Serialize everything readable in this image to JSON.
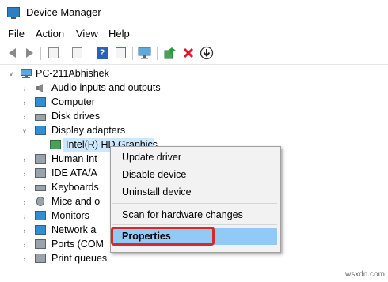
{
  "window": {
    "title": "Device Manager"
  },
  "menubar": [
    "File",
    "Action",
    "View",
    "Help"
  ],
  "toolbar": {
    "icons": [
      "back-arrow-icon",
      "forward-arrow-icon",
      "properties-sheet-icon",
      "list-icon",
      "help-icon",
      "action-icon",
      "monitor-scan-icon",
      "update-driver-icon",
      "uninstall-x-icon",
      "disable-down-icon"
    ],
    "uninstall_color": "#e81123"
  },
  "tree": {
    "root": "PC-211Abhishek",
    "items": [
      {
        "label": "Audio inputs and outputs",
        "icon": "speaker-icon",
        "expander": "›"
      },
      {
        "label": "Computer",
        "icon": "computer-icon",
        "expander": "›"
      },
      {
        "label": "Disk drives",
        "icon": "disk-icon",
        "expander": "›"
      },
      {
        "label": "Display adapters",
        "icon": "display-adapter-icon",
        "expander": "˅"
      },
      {
        "label": "Intel(R) HD Graphics",
        "icon": "display-card-icon",
        "expander": ""
      },
      {
        "label": "Human Int",
        "icon": "hid-icon",
        "expander": "›"
      },
      {
        "label": "IDE ATA/A",
        "icon": "ide-icon",
        "expander": "›"
      },
      {
        "label": "Keyboards",
        "icon": "keyboard-icon",
        "expander": "›"
      },
      {
        "label": "Mice and o",
        "icon": "mouse-icon",
        "expander": "›"
      },
      {
        "label": "Monitors",
        "icon": "monitor-icon",
        "expander": "›"
      },
      {
        "label": "Network a",
        "icon": "network-icon",
        "expander": "›"
      },
      {
        "label": "Ports (COM",
        "icon": "port-icon",
        "expander": "›"
      },
      {
        "label": "Print queues",
        "icon": "printer-icon",
        "expander": "›"
      }
    ]
  },
  "context_menu": {
    "items": [
      "Update driver",
      "Disable device",
      "Uninstall device",
      "Scan for hardware changes",
      "Properties"
    ]
  },
  "watermark": "wsxdn.com"
}
